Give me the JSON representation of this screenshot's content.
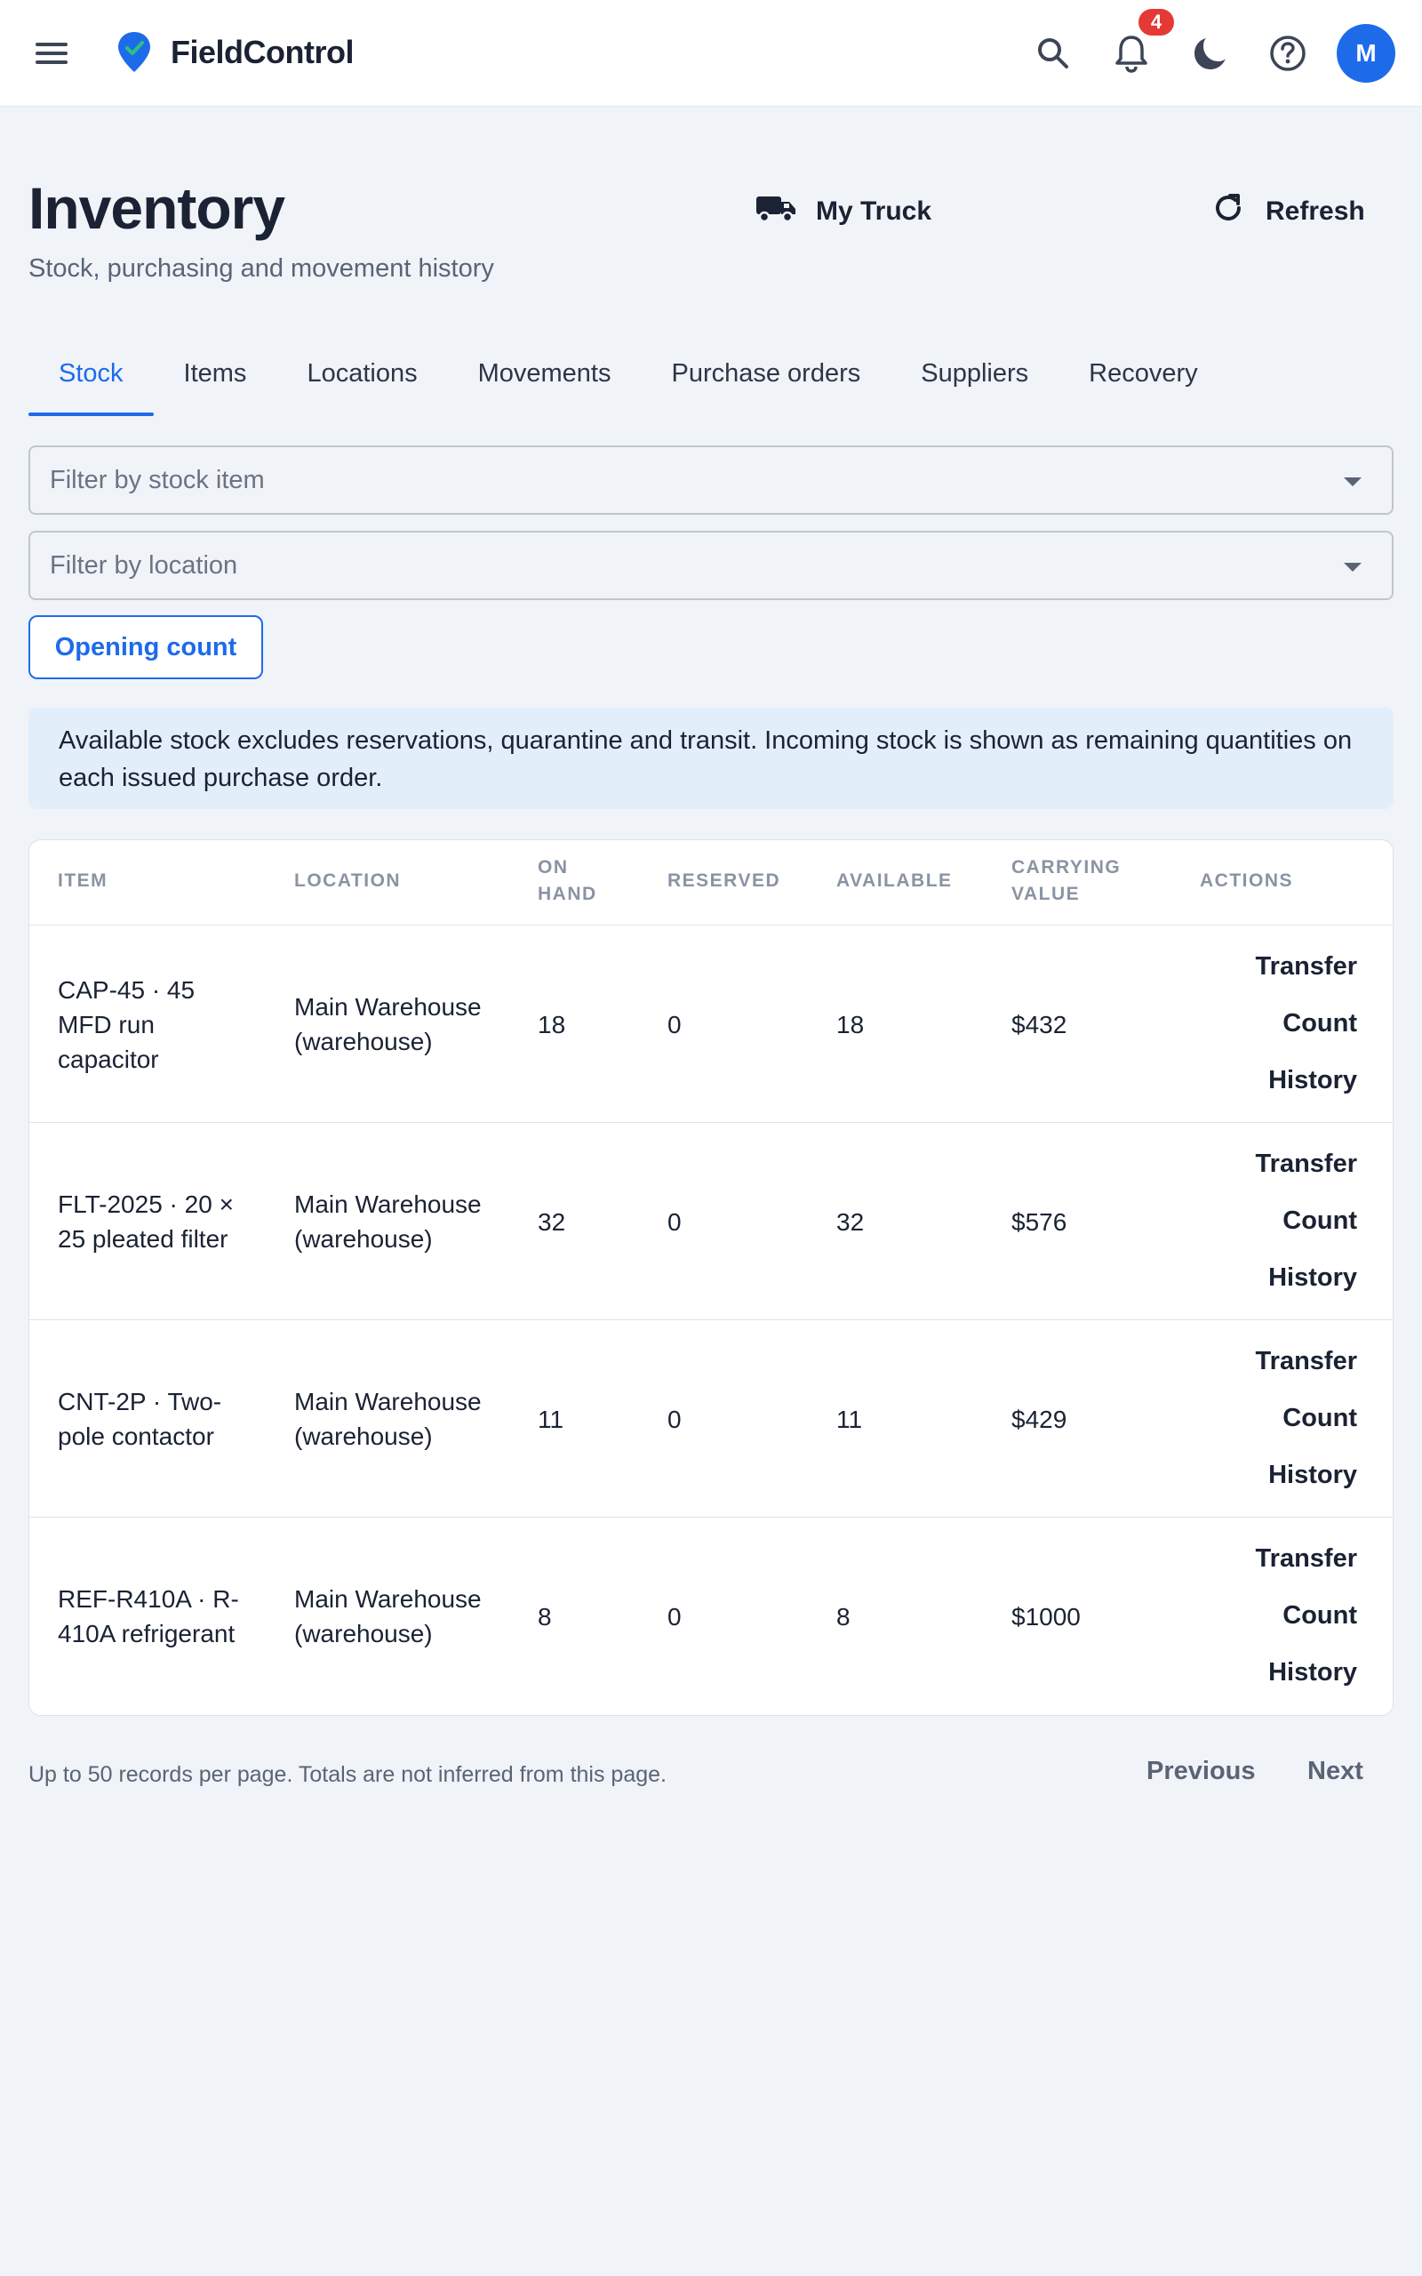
{
  "app": {
    "brand": "FieldControl",
    "notifications_count": "4",
    "avatar_initial": "M"
  },
  "header": {
    "title": "Inventory",
    "subtitle": "Stock, purchasing and movement history",
    "my_truck_label": "My Truck",
    "refresh_label": "Refresh"
  },
  "tabs": [
    {
      "label": "Stock",
      "active": true
    },
    {
      "label": "Items"
    },
    {
      "label": "Locations"
    },
    {
      "label": "Movements"
    },
    {
      "label": "Purchase orders"
    },
    {
      "label": "Suppliers"
    },
    {
      "label": "Recovery"
    }
  ],
  "filters": {
    "stock_item_placeholder": "Filter by stock item",
    "location_placeholder": "Filter by location",
    "opening_count_label": "Opening count"
  },
  "info_text": "Available stock excludes reservations, quarantine and transit. Incoming stock is shown as remaining quantities on each issued purchase order.",
  "table": {
    "columns": [
      "ITEM",
      "LOCATION",
      "ON HAND",
      "RESERVED",
      "AVAILABLE",
      "CARRYING VALUE",
      "ACTIONS"
    ],
    "rows": [
      {
        "item": "CAP-45 · 45 MFD run capacitor",
        "location": "Main Warehouse (warehouse)",
        "on_hand": "18",
        "reserved": "0",
        "available": "18",
        "value": "$432"
      },
      {
        "item": "FLT-2025 · 20 × 25 pleated filter",
        "location": "Main Warehouse (warehouse)",
        "on_hand": "32",
        "reserved": "0",
        "available": "32",
        "value": "$576"
      },
      {
        "item": "CNT-2P · Two-pole contactor",
        "location": "Main Warehouse (warehouse)",
        "on_hand": "11",
        "reserved": "0",
        "available": "11",
        "value": "$429"
      },
      {
        "item": "REF-R410A · R-410A refrigerant",
        "location": "Main Warehouse (warehouse)",
        "on_hand": "8",
        "reserved": "0",
        "available": "8",
        "value": "$1000"
      }
    ],
    "actions": [
      "Transfer",
      "Count",
      "History"
    ]
  },
  "footer": {
    "note": "Up to 50 records per page. Totals are not inferred from this page.",
    "previous_label": "Previous",
    "next_label": "Next"
  }
}
